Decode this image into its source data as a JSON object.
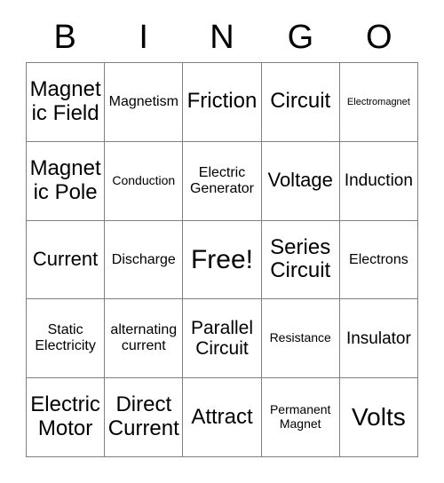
{
  "header": {
    "letters": [
      "B",
      "I",
      "N",
      "G",
      "O"
    ]
  },
  "grid": {
    "rows": 5,
    "columns": 5,
    "border_color": "#808080",
    "background_color": "#ffffff",
    "text_color": "#000000",
    "cells": [
      {
        "text": "Magnetic Field",
        "size": "fs-lg"
      },
      {
        "text": "Magnetism",
        "size": "fs-xs"
      },
      {
        "text": "Friction",
        "size": "fs-lg"
      },
      {
        "text": "Circuit",
        "size": "fs-lg"
      },
      {
        "text": "Electromagnet",
        "size": "fs-tiny"
      },
      {
        "text": "Magnetic Pole",
        "size": "fs-lg"
      },
      {
        "text": "Conduction",
        "size": "fs-xxs"
      },
      {
        "text": "Electric Generator",
        "size": "fs-xs"
      },
      {
        "text": "Voltage",
        "size": "fs-md"
      },
      {
        "text": "Induction",
        "size": "fs-sm"
      },
      {
        "text": "Current",
        "size": "fs-md"
      },
      {
        "text": "Discharge",
        "size": "fs-xs"
      },
      {
        "text": "Free!",
        "size": "fs-xxl"
      },
      {
        "text": "Series Circuit",
        "size": "fs-lg"
      },
      {
        "text": "Electrons",
        "size": "fs-xs"
      },
      {
        "text": "Static Electricity",
        "size": "fs-xs"
      },
      {
        "text": "alternating current",
        "size": "fs-xs"
      },
      {
        "text": "Parallel Circuit",
        "size": "fs-mdl"
      },
      {
        "text": "Resistance",
        "size": "fs-xxs"
      },
      {
        "text": "Insulator",
        "size": "fs-sm"
      },
      {
        "text": "Electric Motor",
        "size": "fs-lg"
      },
      {
        "text": "Direct Current",
        "size": "fs-lg"
      },
      {
        "text": "Attract",
        "size": "fs-lg"
      },
      {
        "text": "Permanent Magnet",
        "size": "fs-xxs"
      },
      {
        "text": "Volts",
        "size": "fs-xl"
      }
    ]
  }
}
